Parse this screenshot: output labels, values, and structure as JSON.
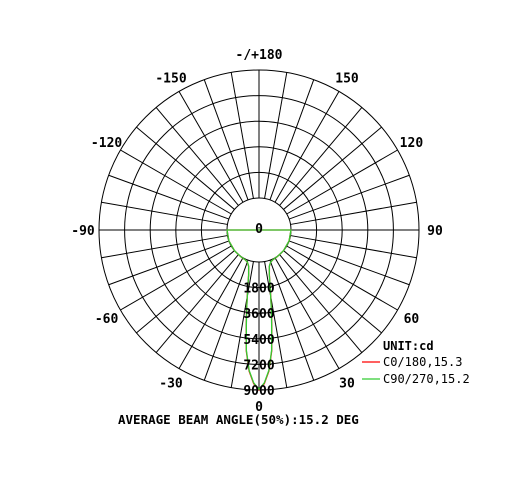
{
  "chart_data": {
    "type": "polar",
    "title": "",
    "unit_label": "UNIT:cd",
    "caption": "AVERAGE BEAM ANGLE(50%):15.2 DEG",
    "angle_labels": [
      "-/+180",
      "150",
      "120",
      "90",
      "60",
      "30",
      "0",
      "-30",
      "-60",
      "-90",
      "-120",
      "-150"
    ],
    "angle_values": [
      180,
      150,
      120,
      90,
      60,
      30,
      0,
      -30,
      -60,
      -90,
      -120,
      -150
    ],
    "radial_tick_labels": [
      "0",
      "1800",
      "3600",
      "5400",
      "7200",
      "9000"
    ],
    "radial_range": [
      0,
      9000
    ],
    "grid": true,
    "legend_position": "bottom-right",
    "series": [
      {
        "name": "C0/180,15.3",
        "color": "#ff0000",
        "angles": [
          0,
          2,
          4,
          6,
          7.65,
          9,
          11,
          13,
          16,
          20,
          25,
          35,
          50,
          70,
          90
        ],
        "values": [
          9000,
          8550,
          7700,
          6300,
          4500,
          3300,
          1900,
          1000,
          400,
          150,
          60,
          20,
          5,
          0,
          0
        ]
      },
      {
        "name": "C90/270,15.2",
        "color": "#33cc33",
        "angles": [
          0,
          2,
          4,
          6,
          7.6,
          9,
          11,
          13,
          16,
          20,
          25,
          35,
          50,
          70,
          90
        ],
        "values": [
          8950,
          8500,
          7650,
          6250,
          4475,
          3250,
          1870,
          980,
          390,
          145,
          55,
          18,
          4,
          0,
          0
        ]
      }
    ]
  }
}
